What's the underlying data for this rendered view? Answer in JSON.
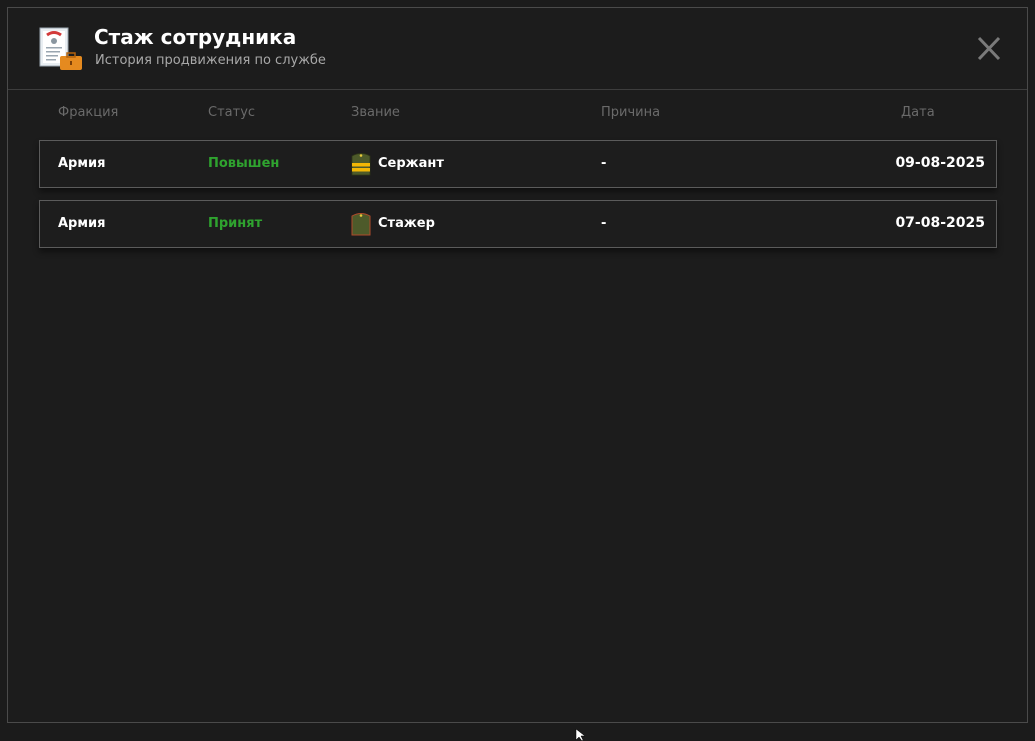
{
  "header": {
    "title": "Стаж сотрудника",
    "subtitle": "История продвижения по службе",
    "icon": "document-briefcase-icon",
    "close_icon": "close-icon"
  },
  "columns": {
    "faction": "Фракция",
    "status": "Статус",
    "rank": "Звание",
    "reason": "Причина",
    "date": "Дата"
  },
  "rows": [
    {
      "faction": "Армия",
      "status": "Повышен",
      "rank": "Сержант",
      "rank_icon": "sergeant-shoulder-strap-icon",
      "reason": "-",
      "date": "09-08-2025"
    },
    {
      "faction": "Армия",
      "status": "Принят",
      "rank": "Стажер",
      "rank_icon": "trainee-shoulder-strap-icon",
      "reason": "-",
      "date": "07-08-2025"
    }
  ],
  "colors": {
    "background": "#1c1c1c",
    "status_green": "#2fa32f",
    "header_text": "#ffffff",
    "muted_text": "#6a6a6a"
  }
}
